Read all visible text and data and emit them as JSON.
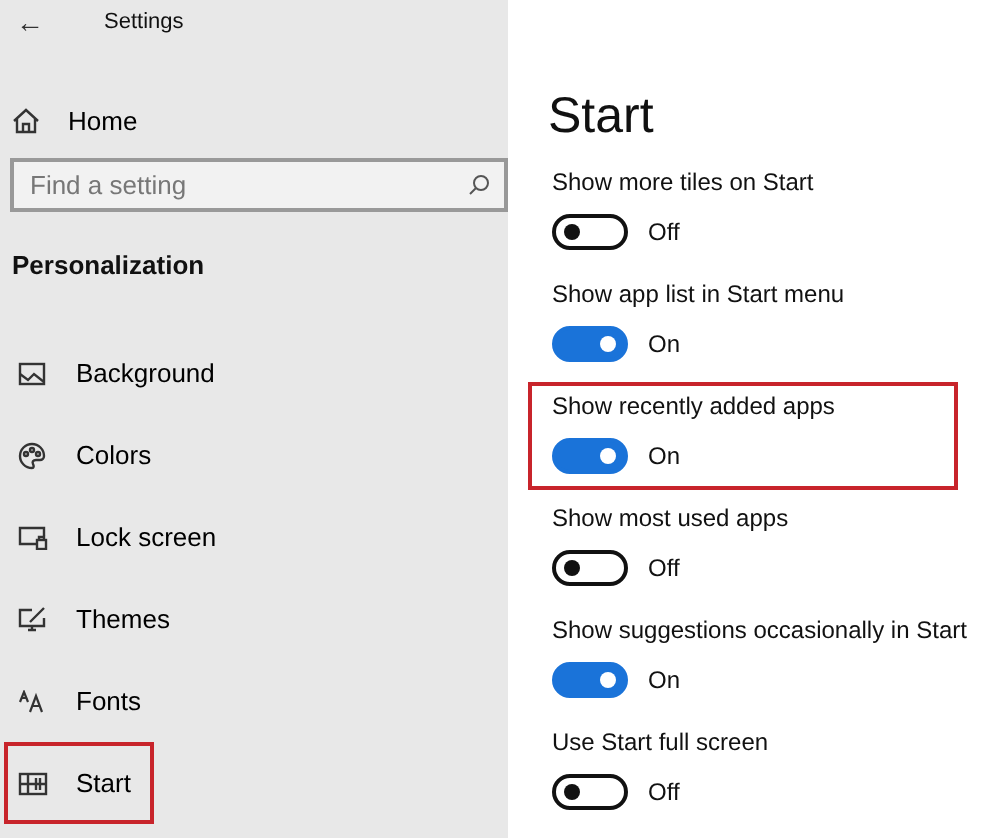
{
  "window": {
    "title": "Settings",
    "back": "←"
  },
  "sidebar": {
    "home": "Home",
    "search": {
      "placeholder": "Find a setting"
    },
    "section": "Personalization",
    "items": [
      {
        "label": "Background",
        "highlighted": false
      },
      {
        "label": "Colors",
        "highlighted": false
      },
      {
        "label": "Lock screen",
        "highlighted": false
      },
      {
        "label": "Themes",
        "highlighted": false
      },
      {
        "label": "Fonts",
        "highlighted": false
      },
      {
        "label": "Start",
        "highlighted": true
      }
    ]
  },
  "page": {
    "title": "Start",
    "settings": [
      {
        "label": "Show more tiles on Start",
        "on": false,
        "state": "Off",
        "highlighted": false
      },
      {
        "label": "Show app list in Start menu",
        "on": true,
        "state": "On",
        "highlighted": false
      },
      {
        "label": "Show recently added apps",
        "on": true,
        "state": "On",
        "highlighted": true
      },
      {
        "label": "Show most used apps",
        "on": false,
        "state": "Off",
        "highlighted": false
      },
      {
        "label": "Show suggestions occasionally in Start",
        "on": true,
        "state": "On",
        "highlighted": false
      },
      {
        "label": "Use Start full screen",
        "on": false,
        "state": "Off",
        "highlighted": false
      }
    ]
  }
}
